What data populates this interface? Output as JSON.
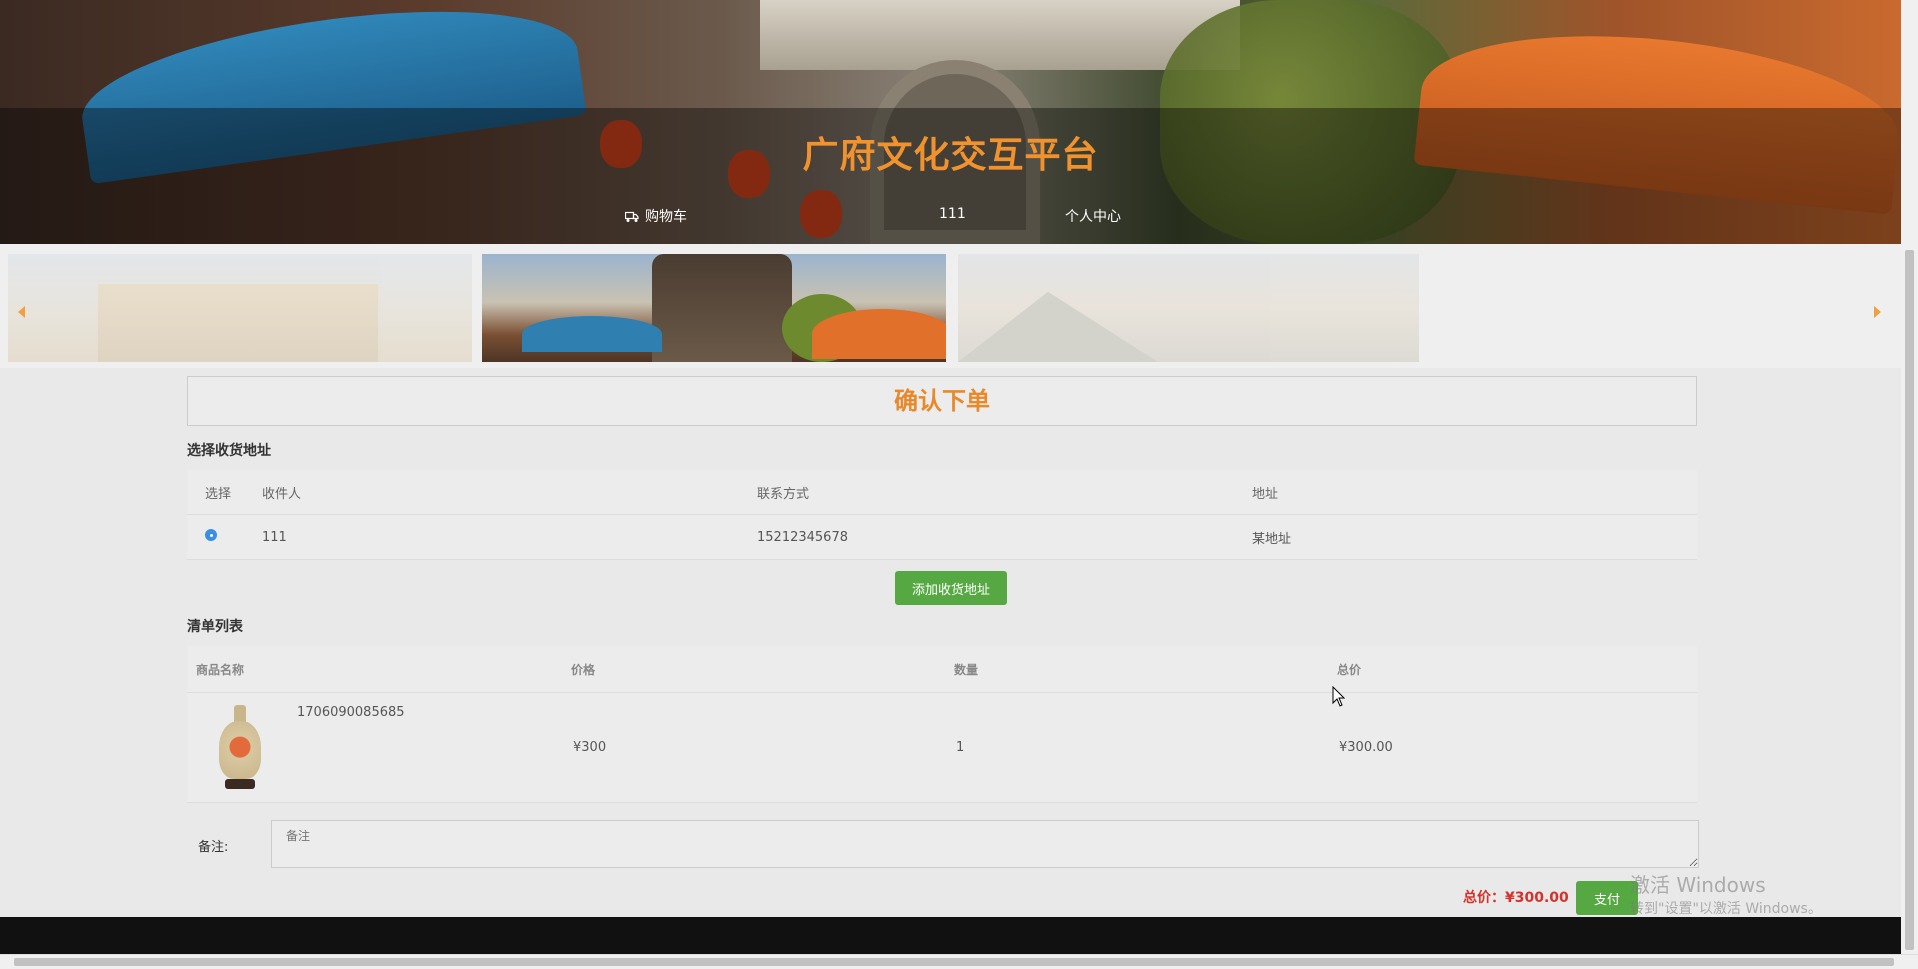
{
  "header": {
    "site_title": "广府文化交互平台",
    "nav": {
      "cart_label": "购物车",
      "username": "111",
      "profile_label": "个人中心"
    }
  },
  "carousel": {
    "prev_icon": "chevron-left-icon",
    "next_icon": "chevron-right-icon"
  },
  "order": {
    "page_heading": "确认下单",
    "address_section_label": "选择收货地址",
    "address_table": {
      "headers": [
        "选择",
        "收件人",
        "联系方式",
        "地址"
      ],
      "rows": [
        {
          "selected": true,
          "recipient": "111",
          "phone": "15212345678",
          "address": "某地址"
        }
      ]
    },
    "add_address_button": "添加收货地址",
    "list_section_label": "清单列表",
    "items_table": {
      "headers": [
        "商品名称",
        "价格",
        "数量",
        "总价"
      ],
      "rows": [
        {
          "name": "1706090085685",
          "price": "¥300",
          "quantity": "1",
          "subtotal": "¥300.00"
        }
      ]
    },
    "remark_label": "备注:",
    "remark_placeholder": "备注",
    "total_label": "总价：",
    "total_value": "¥300.00",
    "pay_button": "支付"
  },
  "os_watermark": {
    "line1": "激活 Windows",
    "line2": "转到\"设置\"以激活 Windows。"
  },
  "colors": {
    "accent_orange": "#f0922e",
    "button_green": "#56a942",
    "price_red": "#d4322b",
    "radio_blue": "#3a8ee6"
  }
}
